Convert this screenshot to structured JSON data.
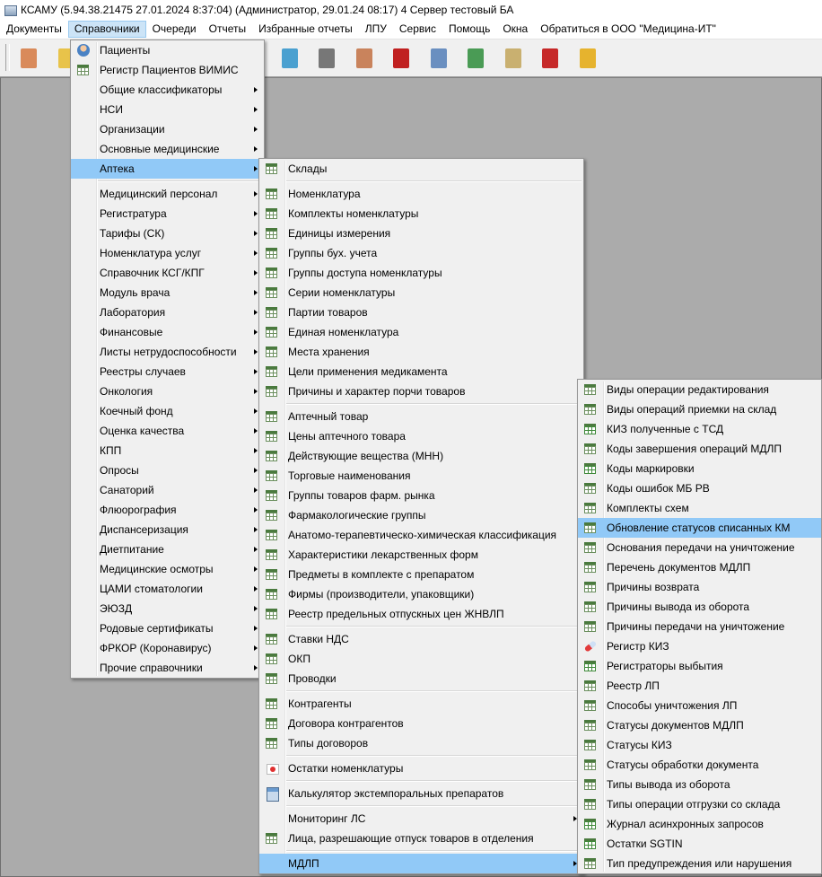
{
  "window": {
    "title": "КСАМУ (5.94.38.21475 27.01.2024 8:37:04) (Администратор, 29.01.24 08:17)  4 Сервер тестовый БА"
  },
  "menubar": [
    "Документы",
    "Справочники",
    "Очереди",
    "Отчеты",
    "Избранные отчеты",
    "ЛПУ",
    "Сервис",
    "Помощь",
    "Окна",
    "Обратиться в ООО \"Медицина-ИТ\""
  ],
  "menubar_active": 1,
  "toolbar_icons": [
    "doctor-icon",
    "folder-icon",
    "schedule-icon",
    "clinic-icon",
    "medical-kit-icon",
    "first-aid-icon",
    "books-icon",
    "drops-icon",
    "barcode-scanner-icon",
    "nurse-icon",
    "red-book-icon",
    "calendar-icon",
    "certificate-icon",
    "registry-icon",
    "pdf-icon",
    "lock-icon"
  ],
  "menu1": [
    {
      "label": "Пациенты",
      "icon": "person"
    },
    {
      "label": "Регистр Пациентов ВИМИС",
      "icon": "grid"
    },
    {
      "label": "Общие классификаторы",
      "sub": true
    },
    {
      "label": "НСИ",
      "sub": true
    },
    {
      "label": "Организации",
      "sub": true
    },
    {
      "label": "Основные медицинские",
      "sub": true
    },
    {
      "label": "Аптека",
      "sub": true,
      "hl": true
    },
    {
      "sep": true
    },
    {
      "label": "Медицинский персонал",
      "sub": true
    },
    {
      "label": "Регистратура",
      "sub": true
    },
    {
      "label": "Тарифы (СК)",
      "sub": true
    },
    {
      "label": "Номенклатура услуг",
      "sub": true
    },
    {
      "label": "Справочник КСГ/КПГ",
      "sub": true
    },
    {
      "label": "Модуль врача",
      "sub": true
    },
    {
      "label": "Лаборатория",
      "sub": true
    },
    {
      "label": "Финансовые",
      "sub": true
    },
    {
      "label": "Листы нетрудоспособности",
      "sub": true
    },
    {
      "label": "Реестры случаев",
      "sub": true
    },
    {
      "label": "Онкология",
      "sub": true
    },
    {
      "label": "Коечный фонд",
      "sub": true
    },
    {
      "label": "Оценка качества",
      "sub": true
    },
    {
      "label": "КПП",
      "sub": true
    },
    {
      "label": "Опросы",
      "sub": true
    },
    {
      "label": "Санаторий",
      "sub": true
    },
    {
      "label": "Флюорография",
      "sub": true
    },
    {
      "label": "Диспансеризация",
      "sub": true
    },
    {
      "label": "Диетпитание",
      "sub": true
    },
    {
      "label": "Медицинские осмотры",
      "sub": true
    },
    {
      "label": "ЦАМИ стоматологии",
      "sub": true
    },
    {
      "label": "ЭЮЗД",
      "sub": true
    },
    {
      "label": "Родовые сертификаты",
      "sub": true
    },
    {
      "label": "ФРКОР (Коронавирус)",
      "sub": true
    },
    {
      "label": "Прочие справочники",
      "sub": true
    }
  ],
  "menu2": [
    {
      "label": "Склады",
      "icon": "grid"
    },
    {
      "sep": true
    },
    {
      "label": "Номенклатура",
      "icon": "grid"
    },
    {
      "label": "Комплекты номенклатуры",
      "icon": "grid"
    },
    {
      "label": "Единицы измерения",
      "icon": "grid"
    },
    {
      "label": "Группы бух. учета",
      "icon": "grid"
    },
    {
      "label": "Группы доступа номенклатуры",
      "icon": "grid"
    },
    {
      "label": "Серии номенклатуры",
      "icon": "grid"
    },
    {
      "label": "Партии товаров",
      "icon": "grid"
    },
    {
      "label": "Единая номенклатура",
      "icon": "grid"
    },
    {
      "label": "Места хранения",
      "icon": "grid"
    },
    {
      "label": "Цели применения медикамента",
      "icon": "grid"
    },
    {
      "label": "Причины и характер порчи товаров",
      "icon": "grid"
    },
    {
      "sep": true
    },
    {
      "label": "Аптечный товар",
      "icon": "grid"
    },
    {
      "label": "Цены аптечного товара",
      "icon": "grid"
    },
    {
      "label": "Действующие вещества (МНН)",
      "icon": "grid"
    },
    {
      "label": "Торговые наименования",
      "icon": "grid"
    },
    {
      "label": "Группы товаров фарм. рынка",
      "icon": "grid"
    },
    {
      "label": "Фармакологические группы",
      "icon": "grid"
    },
    {
      "label": "Анатомо-терапевтическо-химическая классификация",
      "icon": "grid"
    },
    {
      "label": "Характеристики лекарственных форм",
      "icon": "grid"
    },
    {
      "label": "Предметы в комплекте с препаратом",
      "icon": "grid"
    },
    {
      "label": "Фирмы (производители, упаковщики)",
      "icon": "grid"
    },
    {
      "label": "Реестр предельных отпускных цен ЖНВЛП",
      "icon": "grid"
    },
    {
      "sep": true
    },
    {
      "label": "Ставки НДС",
      "icon": "grid"
    },
    {
      "label": "ОКП",
      "icon": "grid"
    },
    {
      "label": "Проводки",
      "icon": "grid"
    },
    {
      "sep": true
    },
    {
      "label": "Контрагенты",
      "icon": "grid"
    },
    {
      "label": "Договора контрагентов",
      "icon": "grid"
    },
    {
      "label": "Типы договоров",
      "icon": "grid"
    },
    {
      "sep": true
    },
    {
      "label": "Остатки номенклатуры",
      "icon": "redbox"
    },
    {
      "sep": true
    },
    {
      "label": "Калькулятор экстемпоральных препаратов",
      "icon": "calc"
    },
    {
      "sep": true
    },
    {
      "label": "Мониторинг ЛС",
      "sub": true
    },
    {
      "label": "Лица, разрешающие отпуск товаров в отделения",
      "icon": "grid"
    },
    {
      "sep": true
    },
    {
      "label": "МДЛП",
      "sub": true,
      "hl": true
    }
  ],
  "menu3": [
    {
      "label": "Виды операции редактирования",
      "icon": "grid"
    },
    {
      "label": "Виды операций приемки на склад",
      "icon": "grid"
    },
    {
      "label": "КИЗ полученные с ТСД",
      "icon": "grid green"
    },
    {
      "label": "Коды завершения операций МДЛП",
      "icon": "grid"
    },
    {
      "label": "Коды маркировки",
      "icon": "grid green"
    },
    {
      "label": "Коды ошибок МБ РВ",
      "icon": "grid"
    },
    {
      "label": "Комплекты схем",
      "icon": "grid"
    },
    {
      "label": "Обновление статусов списанных КМ",
      "icon": "grid",
      "hl": true
    },
    {
      "label": "Основания передачи на уничтожение",
      "icon": "grid"
    },
    {
      "label": "Перечень документов МДЛП",
      "icon": "grid"
    },
    {
      "label": "Причины возврата",
      "icon": "grid"
    },
    {
      "label": "Причины вывода из оборота",
      "icon": "grid"
    },
    {
      "label": "Причины передачи на уничтожение",
      "icon": "grid"
    },
    {
      "label": "Регистр КИЗ",
      "icon": "pill"
    },
    {
      "label": "Регистраторы выбытия",
      "icon": "grid green"
    },
    {
      "label": "Реестр ЛП",
      "icon": "grid"
    },
    {
      "label": "Способы уничтожения ЛП",
      "icon": "grid"
    },
    {
      "label": "Статусы документов МДЛП",
      "icon": "grid"
    },
    {
      "label": "Статусы КИЗ",
      "icon": "grid"
    },
    {
      "label": "Статусы обработки документа",
      "icon": "grid"
    },
    {
      "label": "Типы вывода из оборота",
      "icon": "grid"
    },
    {
      "label": "Типы операции отгрузки со склада",
      "icon": "grid"
    },
    {
      "label": "Журнал асинхронных запросов",
      "icon": "grid green"
    },
    {
      "label": "Остатки SGTIN",
      "icon": "grid green"
    },
    {
      "label": "Тип предупреждения или нарушения",
      "icon": "grid"
    }
  ],
  "colors": {
    "highlight": "#91c9f7",
    "menubar_active": "#cce4f7",
    "workspace": "#ababab"
  }
}
